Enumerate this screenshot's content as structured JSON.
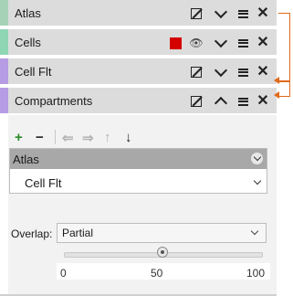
{
  "layers": [
    {
      "name": "Atlas",
      "bar_color": "#a6d3b8",
      "buttons": [
        "edit",
        "collapse",
        "menu",
        "close"
      ]
    },
    {
      "name": "Cells",
      "bar_color": "#8fd6b4",
      "swatch_color": "#d40000",
      "buttons": [
        "visibility",
        "collapse",
        "menu",
        "close"
      ]
    },
    {
      "name": "Cell Flt",
      "bar_color": "#b69ce2",
      "buttons": [
        "edit",
        "collapse",
        "menu",
        "close"
      ]
    },
    {
      "name": "Compartments",
      "bar_color": "#b69ce2",
      "buttons": [
        "edit",
        "expand",
        "menu",
        "close"
      ]
    }
  ],
  "icons": {
    "edit": "✎",
    "eye": "👁",
    "close": "✕",
    "add": "+",
    "remove": "−",
    "left": "⇐",
    "right": "⇒",
    "up": "↑",
    "down": "↓"
  },
  "connector_color": "#e06a1a",
  "panel": {
    "list_header": "Atlas",
    "list_items": [
      "Cell Flt"
    ]
  },
  "overlap": {
    "label": "Overlap:",
    "value": "Partial"
  },
  "slider": {
    "min_label": "0",
    "mid_label": "50",
    "max_label": "100",
    "value": 50
  }
}
